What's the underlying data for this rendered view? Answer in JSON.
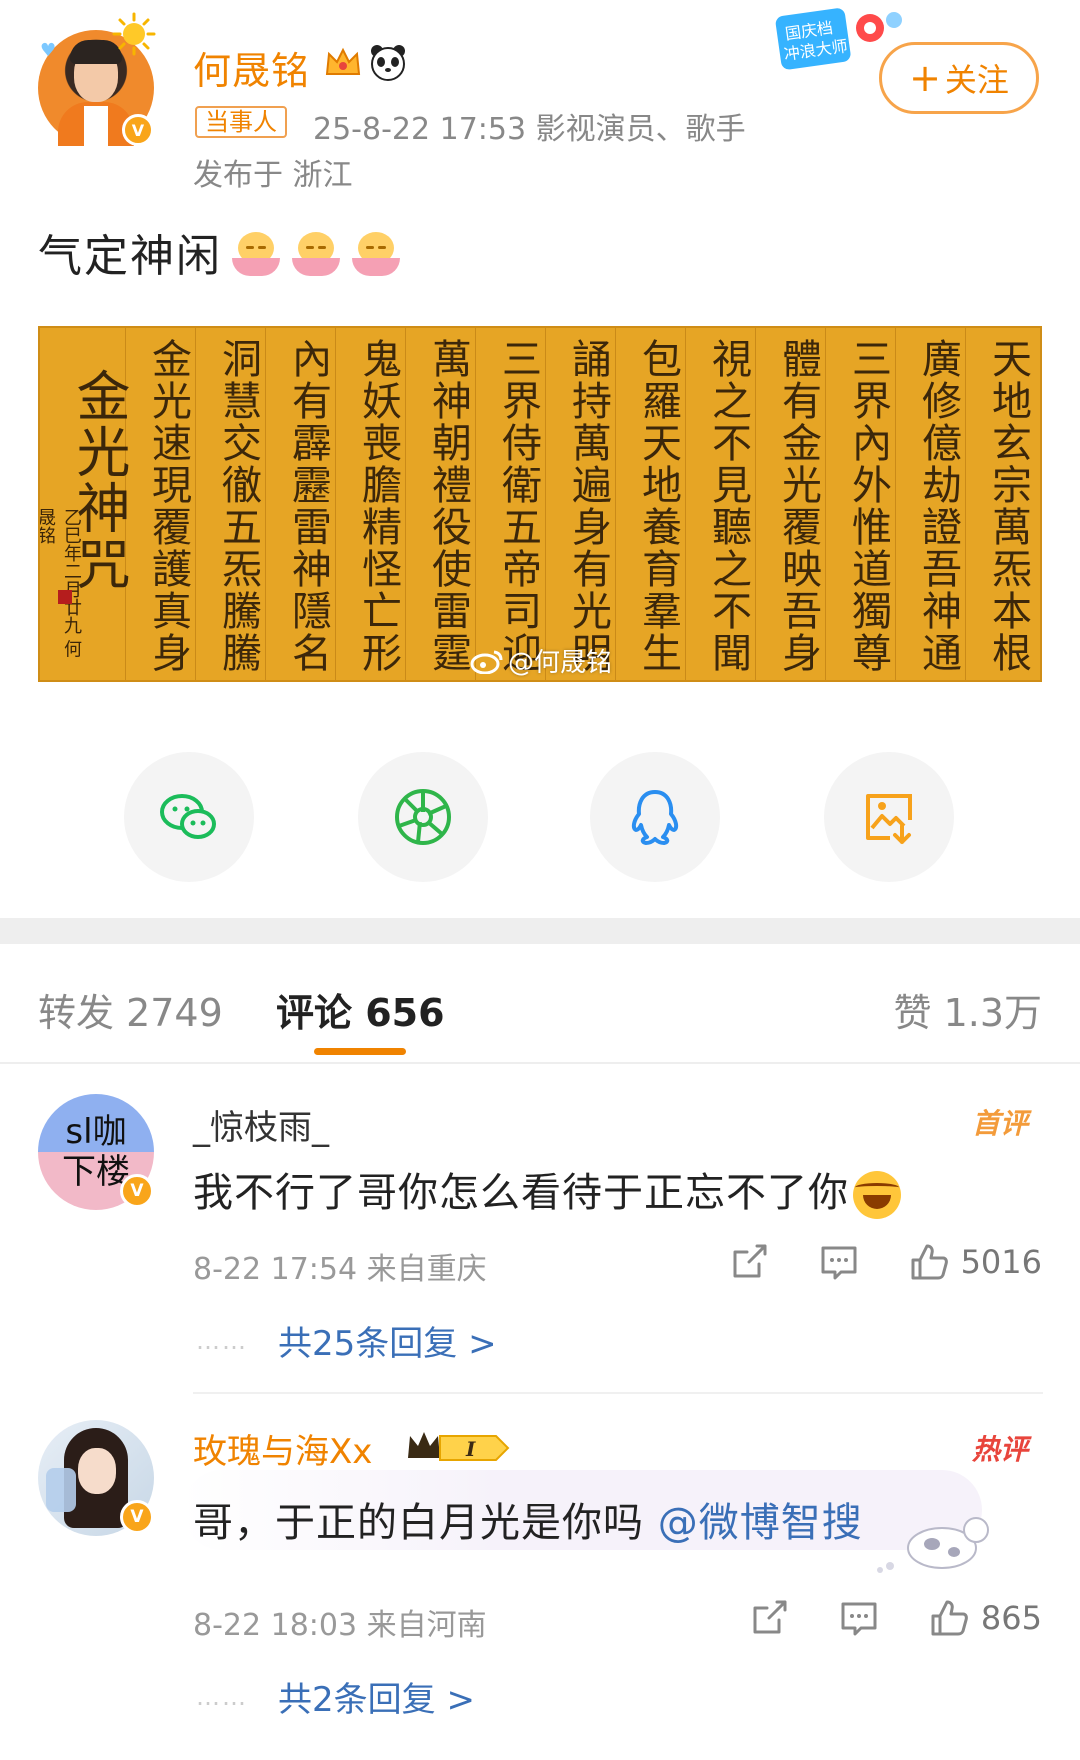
{
  "post": {
    "author": "何晟铭",
    "tag": "当事人",
    "meta": "25-8-22 17:53  影视演员、歌手",
    "location": "发布于 浙江",
    "follow_label": "关注",
    "text": "气定神闲",
    "watermark": "@何晟铭",
    "calligraphy_columns": [
      "天地玄宗萬炁本根",
      "廣修億劫證吾神通",
      "三界內外惟道獨尊",
      "體有金光覆映吾身",
      "視之不見聽之不聞",
      "包羅天地養育羣生",
      "誦持萬遍身有光明",
      "三界侍衛五帝司迎",
      "萬神朝禮役使雷霆",
      "鬼妖喪膽精怪亡形",
      "內有霹靂雷神隱名",
      "洞慧交徹五炁騰騰",
      "金光速現覆護真身",
      "金光神咒"
    ],
    "signature": "乙巳年二月廿九 何晟铭"
  },
  "share": {
    "items": [
      "wechat-icon",
      "moments-icon",
      "qq-icon",
      "save-image-icon"
    ],
    "colors": {
      "wechat": "#1bbc5a",
      "moments": "#2fb54a",
      "qq": "#2a8ef0",
      "save": "#f7a21b"
    }
  },
  "tabs": {
    "repost": "转发 2749",
    "comments": "评论 656",
    "likes": "赞 1.3万",
    "accent": "#f08300"
  },
  "comments": [
    {
      "avatar_text_line1": "sl咖",
      "avatar_text_line2": "下楼",
      "name": "_惊枝雨_",
      "badge": "首评",
      "text": "我不行了哥你怎么看待于正忘不了你",
      "meta": "8-22 17:54  来自重庆",
      "likes": "5016",
      "replies": "共25条回复 >"
    },
    {
      "name": "玫瑰与海Xx",
      "badge": "热评",
      "text": "哥，于正的白月光是你吗",
      "mention": "@微博智搜",
      "meta": "8-22 18:03  来自河南",
      "likes": "865",
      "replies": "共2条回复 >"
    }
  ]
}
